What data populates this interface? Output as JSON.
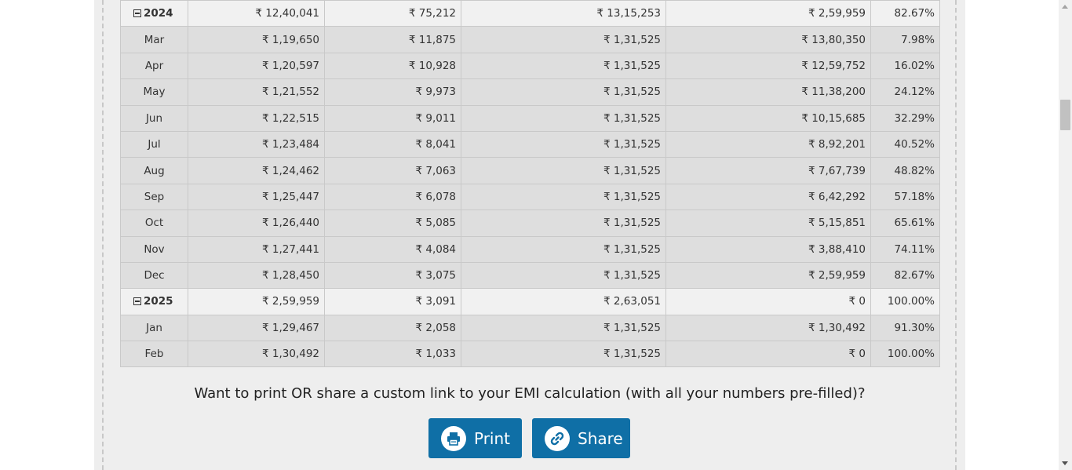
{
  "schedule": {
    "rows": [
      {
        "type": "year",
        "period": "2024",
        "principal": "₹ 12,40,041",
        "interest": "₹ 75,212",
        "total_payment": "₹ 13,15,253",
        "balance": "₹ 2,59,959",
        "loan_paid": "82.67%"
      },
      {
        "type": "month",
        "period": "Mar",
        "principal": "₹ 1,19,650",
        "interest": "₹ 11,875",
        "total_payment": "₹ 1,31,525",
        "balance": "₹ 13,80,350",
        "loan_paid": "7.98%"
      },
      {
        "type": "month",
        "period": "Apr",
        "principal": "₹ 1,20,597",
        "interest": "₹ 10,928",
        "total_payment": "₹ 1,31,525",
        "balance": "₹ 12,59,752",
        "loan_paid": "16.02%"
      },
      {
        "type": "month",
        "period": "May",
        "principal": "₹ 1,21,552",
        "interest": "₹ 9,973",
        "total_payment": "₹ 1,31,525",
        "balance": "₹ 11,38,200",
        "loan_paid": "24.12%"
      },
      {
        "type": "month",
        "period": "Jun",
        "principal": "₹ 1,22,515",
        "interest": "₹ 9,011",
        "total_payment": "₹ 1,31,525",
        "balance": "₹ 10,15,685",
        "loan_paid": "32.29%"
      },
      {
        "type": "month",
        "period": "Jul",
        "principal": "₹ 1,23,484",
        "interest": "₹ 8,041",
        "total_payment": "₹ 1,31,525",
        "balance": "₹ 8,92,201",
        "loan_paid": "40.52%"
      },
      {
        "type": "month",
        "period": "Aug",
        "principal": "₹ 1,24,462",
        "interest": "₹ 7,063",
        "total_payment": "₹ 1,31,525",
        "balance": "₹ 7,67,739",
        "loan_paid": "48.82%"
      },
      {
        "type": "month",
        "period": "Sep",
        "principal": "₹ 1,25,447",
        "interest": "₹ 6,078",
        "total_payment": "₹ 1,31,525",
        "balance": "₹ 6,42,292",
        "loan_paid": "57.18%"
      },
      {
        "type": "month",
        "period": "Oct",
        "principal": "₹ 1,26,440",
        "interest": "₹ 5,085",
        "total_payment": "₹ 1,31,525",
        "balance": "₹ 5,15,851",
        "loan_paid": "65.61%"
      },
      {
        "type": "month",
        "period": "Nov",
        "principal": "₹ 1,27,441",
        "interest": "₹ 4,084",
        "total_payment": "₹ 1,31,525",
        "balance": "₹ 3,88,410",
        "loan_paid": "74.11%"
      },
      {
        "type": "month",
        "period": "Dec",
        "principal": "₹ 1,28,450",
        "interest": "₹ 3,075",
        "total_payment": "₹ 1,31,525",
        "balance": "₹ 2,59,959",
        "loan_paid": "82.67%"
      },
      {
        "type": "year",
        "period": "2025",
        "principal": "₹ 2,59,959",
        "interest": "₹ 3,091",
        "total_payment": "₹ 2,63,051",
        "balance": "₹ 0",
        "loan_paid": "100.00%"
      },
      {
        "type": "month",
        "period": "Jan",
        "principal": "₹ 1,29,467",
        "interest": "₹ 2,058",
        "total_payment": "₹ 1,31,525",
        "balance": "₹ 1,30,492",
        "loan_paid": "91.30%"
      },
      {
        "type": "month",
        "period": "Feb",
        "principal": "₹ 1,30,492",
        "interest": "₹ 1,033",
        "total_payment": "₹ 1,31,525",
        "balance": "₹ 0",
        "loan_paid": "100.00%"
      }
    ]
  },
  "share_section": {
    "prompt": "Want to print OR share a custom link to your EMI calculation (with all your numbers pre-filled)?",
    "print_label": "Print",
    "print_icon": "printer-icon",
    "share_label": "Share",
    "share_icon": "link-icon",
    "button_color": "#0f6fa6"
  }
}
